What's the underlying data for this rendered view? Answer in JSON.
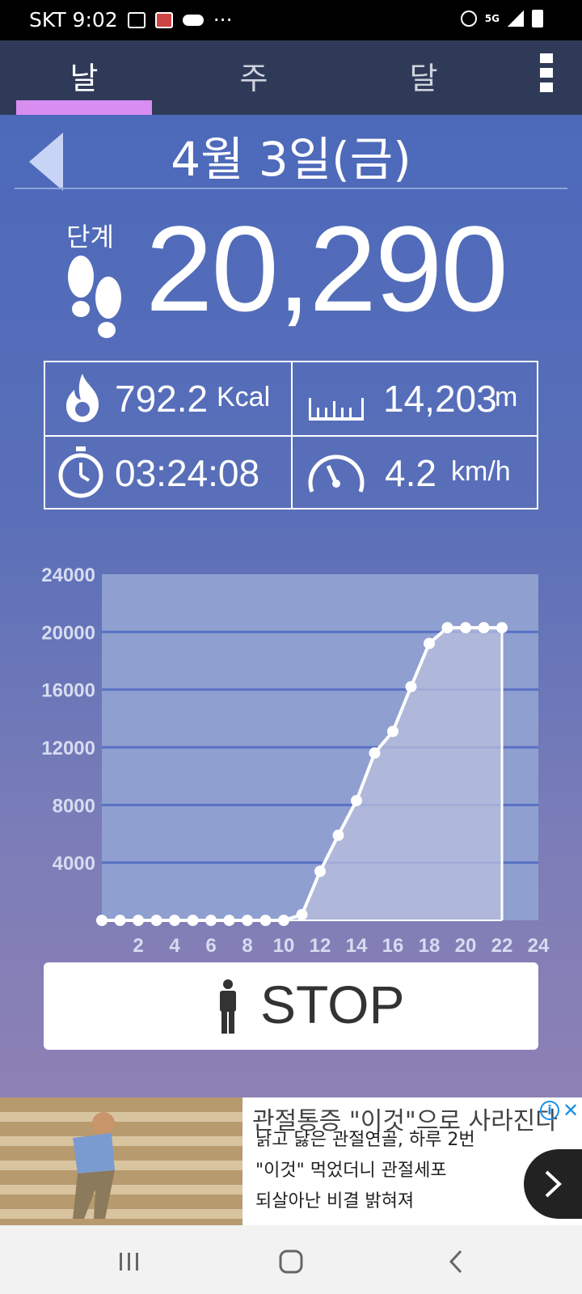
{
  "status_bar": {
    "carrier_time": "SKT 9:02",
    "more": "···",
    "network": "5G"
  },
  "tabs": [
    {
      "label": "날",
      "active": true
    },
    {
      "label": "주",
      "active": false
    },
    {
      "label": "달",
      "active": false
    }
  ],
  "date": "4월 3일(금)",
  "steps": {
    "label": "단계",
    "value": "20,290"
  },
  "stats": {
    "calories": {
      "value": "792.2",
      "unit": "Kcal"
    },
    "distance": {
      "value": "14,203",
      "unit": "m"
    },
    "duration": {
      "value": "03:24:08"
    },
    "speed": {
      "value": "4.2",
      "unit": "km/h"
    }
  },
  "chart_data": {
    "type": "line",
    "x": [
      0,
      1,
      2,
      3,
      4,
      5,
      6,
      7,
      8,
      9,
      10,
      11,
      12,
      13,
      14,
      15,
      16,
      17,
      18,
      19,
      20,
      21,
      22
    ],
    "y": [
      0,
      0,
      0,
      0,
      0,
      0,
      0,
      0,
      0,
      0,
      0,
      400,
      3400,
      5900,
      8300,
      11600,
      13100,
      16200,
      19200,
      20290,
      20290,
      20290,
      20290
    ],
    "xticks": [
      2,
      4,
      6,
      8,
      10,
      12,
      14,
      16,
      18,
      20,
      22,
      24
    ],
    "yticks": [
      4000,
      8000,
      12000,
      16000,
      20000,
      24000
    ],
    "xlim": [
      0,
      24
    ],
    "ylim": [
      0,
      24000
    ],
    "grid": true,
    "colors": {
      "line": "#ffffff",
      "fill": "#b9c0de",
      "plot_bg": "#8f9fd0",
      "grid": "#5a72c4",
      "tick": "#d6dcf0"
    }
  },
  "stop_button": {
    "label": "STOP"
  },
  "ad": {
    "headline": "관절통증 \"이것\"으로 사라진다",
    "lines": [
      "낡고 닳은 관절연골, 하루 2번",
      "\"이것\" 먹었더니 관절세포",
      "되살아난 비결 밝혀져"
    ],
    "info": "i",
    "close": "✕"
  },
  "nav": {
    "recents_icon": "recents-icon",
    "home_icon": "home-icon",
    "back_icon": "back-icon"
  }
}
